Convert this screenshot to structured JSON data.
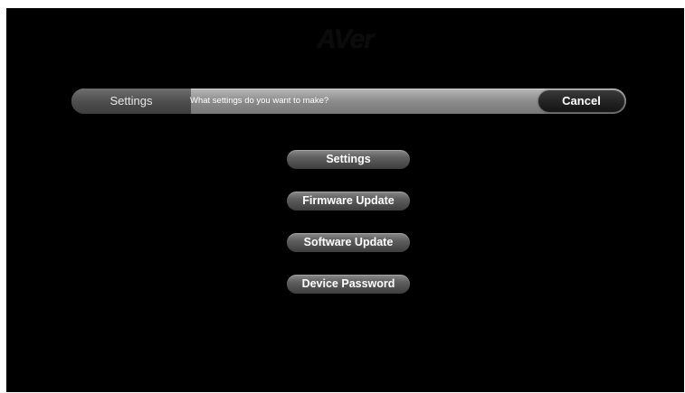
{
  "brand": {
    "logo_text": "AVer"
  },
  "header": {
    "section_title": "Settings",
    "prompt": "What settings do you want to make?",
    "cancel_label": "Cancel"
  },
  "menu": {
    "items": [
      {
        "label": "Settings"
      },
      {
        "label": "Firmware Update"
      },
      {
        "label": "Software Update"
      },
      {
        "label": "Device Password"
      }
    ]
  },
  "colors": {
    "background": "#000000",
    "header_bar": "#8c8c8c",
    "button_dark": "#222222",
    "button_gray": "#5e5e5e",
    "text": "#ffffff"
  }
}
